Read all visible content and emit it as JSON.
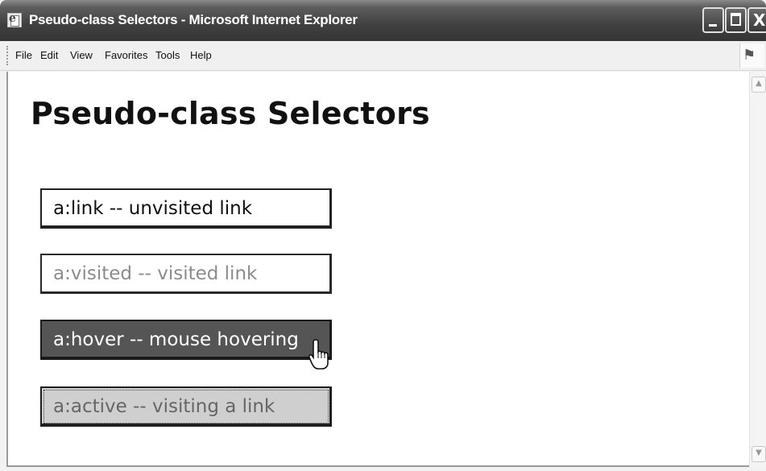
{
  "window": {
    "title": "Pseudo-class Selectors - Microsoft Internet Explorer"
  },
  "menu": {
    "items": [
      {
        "label": "File"
      },
      {
        "label": "Edit"
      },
      {
        "label": "View"
      },
      {
        "label": "Favorites"
      },
      {
        "label": "Tools"
      },
      {
        "label": "Help"
      }
    ]
  },
  "page": {
    "heading": "Pseudo-class Selectors",
    "links": [
      {
        "label": "a:link -- unvisited link",
        "state": "link"
      },
      {
        "label": "a:visited -- visited link",
        "state": "visited"
      },
      {
        "label": "a:hover -- mouse hovering",
        "state": "hover"
      },
      {
        "label": "a:active -- visiting a link",
        "state": "active"
      }
    ]
  },
  "colors": {
    "titlebar": "#404040",
    "hover_background": "#555555",
    "active_background": "#cfcfcf",
    "visited_text": "#8c8c8c"
  },
  "icons": [
    "ie-page-icon",
    "minimize-icon",
    "maximize-icon",
    "close-icon",
    "windows-flag-icon",
    "hand-cursor-icon"
  ]
}
